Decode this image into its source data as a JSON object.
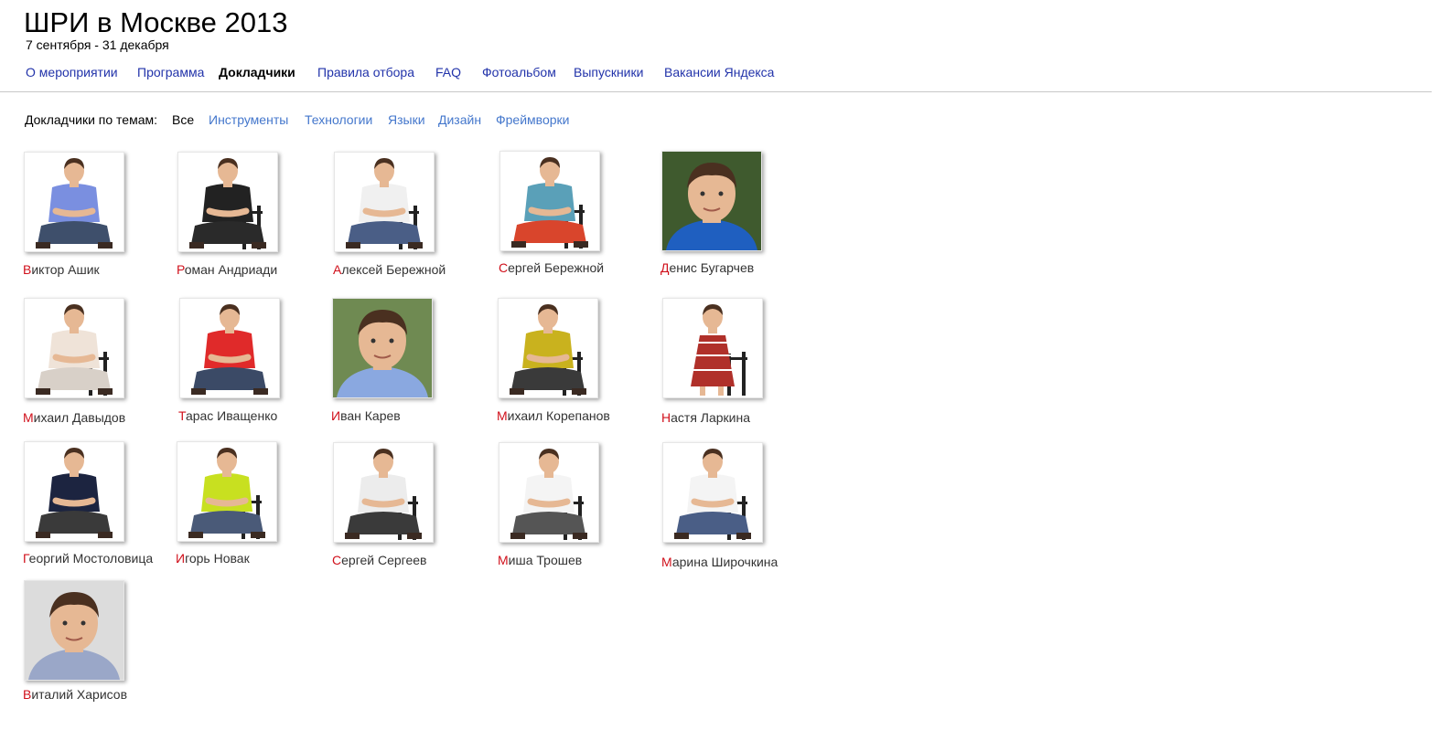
{
  "header": {
    "title": "ШРИ в Москве 2013",
    "dates": "7 сентября - 31 декабря"
  },
  "nav": {
    "items": [
      {
        "label": "О мероприятии",
        "active": false
      },
      {
        "label": "Программа",
        "active": false
      },
      {
        "label": "Докладчики",
        "active": true
      },
      {
        "label": "Правила отбора",
        "active": false
      },
      {
        "label": "FAQ",
        "active": false
      },
      {
        "label": "Фотоальбом",
        "active": false
      },
      {
        "label": "Выпускники",
        "active": false
      },
      {
        "label": "Вакансии Яндекса",
        "active": false
      }
    ]
  },
  "filters": {
    "label": "Докладчики по темам:",
    "items": [
      {
        "label": "Все",
        "active": true
      },
      {
        "label": "Инструменты",
        "active": false
      },
      {
        "label": "Технологии",
        "active": false
      },
      {
        "label": "Языки",
        "active": false
      },
      {
        "label": "Дизайн",
        "active": false
      },
      {
        "label": "Фреймворки",
        "active": false
      }
    ]
  },
  "colors": {
    "link": "#2233aa",
    "filter_link": "#4477cc",
    "initial_letter": "#d0101b",
    "divider": "#c8c8c8"
  },
  "speakers": [
    {
      "initial": "В",
      "rest": "иктор Ашик",
      "photo": {
        "bg": "#ffffff",
        "shirt": "#7a8fe0",
        "pants": "#3e4f6b",
        "chair": false,
        "pose": "full"
      }
    },
    {
      "initial": "Р",
      "rest": "оман Андриади",
      "photo": {
        "bg": "#ffffff",
        "shirt": "#222222",
        "pants": "#2a2a2a",
        "chair": true,
        "pose": "full"
      }
    },
    {
      "initial": "А",
      "rest": "лексей Бережной",
      "photo": {
        "bg": "#ffffff",
        "shirt": "#f0f0f0",
        "pants": "#4a5e86",
        "chair": true,
        "pose": "full"
      }
    },
    {
      "initial": "С",
      "rest": "ергей Бережной",
      "photo": {
        "bg": "#ffffff",
        "shirt": "#5aa0b8",
        "pants": "#d9452c",
        "chair": true,
        "pose": "full"
      }
    },
    {
      "initial": "Д",
      "rest": "енис Бугарчев",
      "photo": {
        "bg": "#3f5a2e",
        "shirt": "#1f5fc0",
        "pants": "#1f5fc0",
        "chair": false,
        "pose": "portrait"
      }
    },
    {
      "initial": "М",
      "rest": "ихаил Давыдов",
      "photo": {
        "bg": "#ffffff",
        "shirt": "#efe3d8",
        "pants": "#d8d0c8",
        "chair": true,
        "pose": "full"
      }
    },
    {
      "initial": "Т",
      "rest": "арас Иващенко",
      "photo": {
        "bg": "#ffffff",
        "shirt": "#e02a2a",
        "pants": "#3b4a66",
        "chair": false,
        "pose": "full"
      }
    },
    {
      "initial": "И",
      "rest": "ван Карев",
      "photo": {
        "bg": "#6f8a52",
        "shirt": "#8aa8e0",
        "pants": "#8aa8e0",
        "chair": false,
        "pose": "portrait"
      }
    },
    {
      "initial": "М",
      "rest": "ихаил Корепанов",
      "photo": {
        "bg": "#ffffff",
        "shirt": "#c9b21e",
        "pants": "#3a3a3a",
        "chair": true,
        "pose": "full"
      }
    },
    {
      "initial": "Н",
      "rest": "астя Ларкина",
      "photo": {
        "bg": "#ffffff",
        "shirt": "#b0302a",
        "pants": "#b0302a",
        "chair": true,
        "pose": "dress"
      }
    },
    {
      "initial": "Г",
      "rest": "еоргий Мостоловица",
      "photo": {
        "bg": "#ffffff",
        "shirt": "#1c2440",
        "pants": "#3a3a3a",
        "chair": false,
        "pose": "full"
      }
    },
    {
      "initial": "И",
      "rest": "горь Новак",
      "photo": {
        "bg": "#ffffff",
        "shirt": "#c8e020",
        "pants": "#4a5a78",
        "chair": true,
        "pose": "full"
      }
    },
    {
      "initial": "С",
      "rest": "ергей Сергеев",
      "photo": {
        "bg": "#ffffff",
        "shirt": "#ececec",
        "pants": "#3a3a3a",
        "chair": true,
        "pose": "full"
      }
    },
    {
      "initial": "М",
      "rest": "иша Трошев",
      "photo": {
        "bg": "#ffffff",
        "shirt": "#f4f4f4",
        "pants": "#555555",
        "chair": true,
        "pose": "full"
      }
    },
    {
      "initial": "М",
      "rest": "арина Широчкина",
      "photo": {
        "bg": "#ffffff",
        "shirt": "#f4f4f4",
        "pants": "#4a5e86",
        "chair": true,
        "pose": "full"
      }
    },
    {
      "initial": "В",
      "rest": "италий Харисов",
      "photo": {
        "bg": "#dcdcdc",
        "shirt": "#9aa7c8",
        "pants": "#9aa7c8",
        "chair": false,
        "pose": "portrait"
      }
    }
  ]
}
